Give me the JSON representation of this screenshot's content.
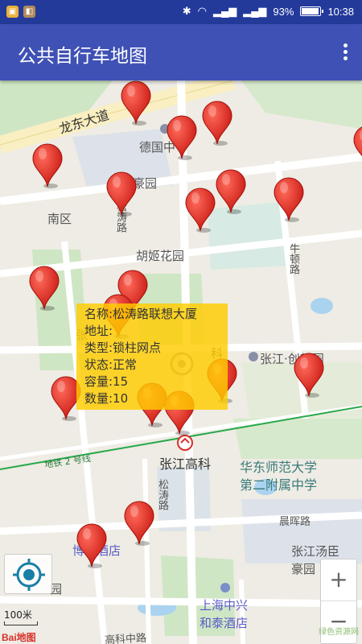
{
  "status_bar": {
    "battery_percent": "93%",
    "battery_level": 0.93,
    "time": "10:38",
    "icons": [
      "notification-icon",
      "app-icon",
      "bluetooth-icon",
      "wifi-icon",
      "signal-icon",
      "signal-icon"
    ]
  },
  "app_bar": {
    "title": "公共自行车地图"
  },
  "map": {
    "labels": {
      "road_longdong": "龙东大道",
      "deguo": "德国中",
      "haoyuan": "豪园",
      "nanqu": "南区",
      "songtao_road_1": "松涛路",
      "huji_garden": "胡姬花园",
      "niudun_road": "牛顿路",
      "zhangjiang_chuangxin": "张江·创新园",
      "zhangjiang_gaoke": "张江高科",
      "metro_line2": "地铁 2 号线",
      "huadong_school_1": "华东师范大学",
      "huadong_school_2": "第二附属中学",
      "songtao_road_2": "松涛路",
      "chenhui_road": "晨晖路",
      "hotel_fragment": "博",
      "hotel_fragment2": "酒店",
      "zhangjiang_tangchen_1": "张江汤臣",
      "zhangjiang_tangchen_2": "豪园",
      "shanghai_hotel_1": "上海中兴",
      "shanghai_hotel_2": "和泰酒店",
      "ke": "科",
      "zhang": "张",
      "yuan": "园",
      "gaoke_road": "高科中路"
    },
    "info_window": {
      "name": "名称:松涛路联想大厦",
      "address": "地址:",
      "type": "类型:锁柱网点",
      "status": "状态:正常",
      "capacity": "容量:15",
      "count": "数量:10"
    },
    "controls": {
      "zoom_in": "+",
      "zoom_out": "−",
      "scale": "100米",
      "logo": "Bai地图",
      "watermark": "绿色资源网"
    }
  }
}
